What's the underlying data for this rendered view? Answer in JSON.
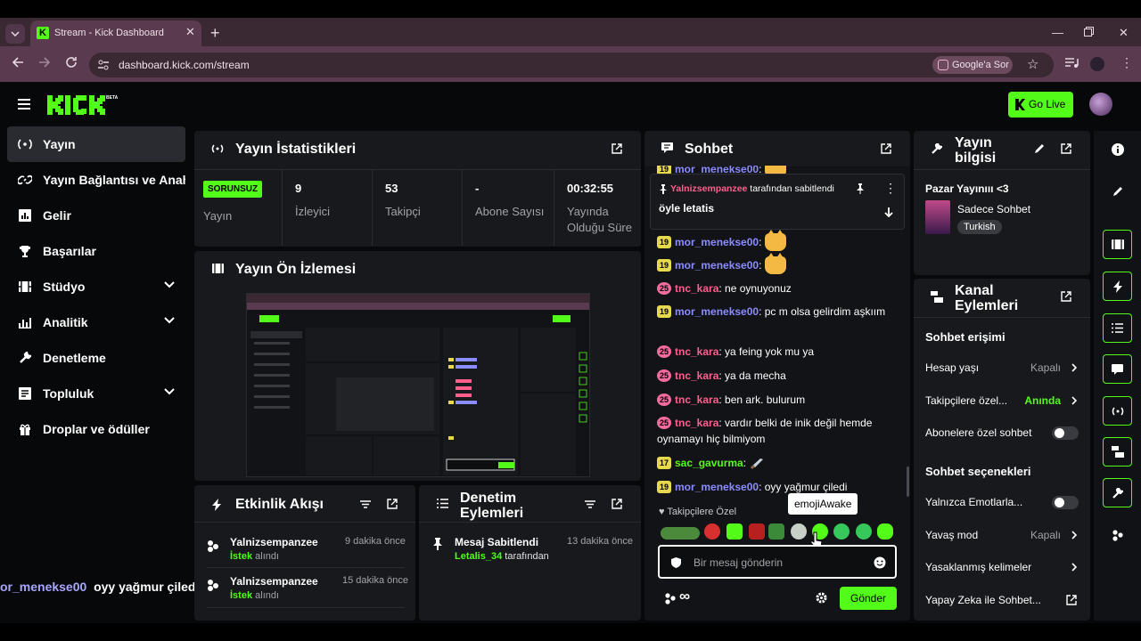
{
  "browser": {
    "tab_title": "Stream - Kick Dashboard",
    "url": "dashboard.kick.com/stream",
    "google_ask": "Google'a Sor"
  },
  "header": {
    "logo": "KICK",
    "beta": "BETA",
    "go_live": "Go Live"
  },
  "sidebar": {
    "items": [
      {
        "label": "Yayın"
      },
      {
        "label": "Yayın Bağlantısı ve Anahtarı"
      },
      {
        "label": "Gelir"
      },
      {
        "label": "Başarılar"
      },
      {
        "label": "Stüdyo"
      },
      {
        "label": "Analitik"
      },
      {
        "label": "Denetleme"
      },
      {
        "label": "Topluluk"
      },
      {
        "label": "Droplar ve ödüller"
      }
    ],
    "ticker_user": "or_menekse00",
    "ticker_text": "oyy yağmur çiledi"
  },
  "stats": {
    "title": "Yayın İstatistikleri",
    "badge": "SORUNSUZ",
    "items": [
      {
        "value": "",
        "label": "Yayın"
      },
      {
        "value": "9",
        "label": "İzleyici"
      },
      {
        "value": "53",
        "label": "Takipçi"
      },
      {
        "value": "-",
        "label": "Abone Sayısı"
      },
      {
        "value": "00:32:55",
        "label": "Yayında Olduğu Süre"
      }
    ]
  },
  "preview": {
    "title": "Yayın Ön İzlemesi"
  },
  "activity": {
    "title": "Etkinlik Akışı",
    "items": [
      {
        "name": "Yalnizsempanzee",
        "time": "9 dakika önce",
        "action": "İstek",
        "suffix": "alındı"
      },
      {
        "name": "Yalnizsempanzee",
        "time": "15 dakika önce",
        "action": "İstek",
        "suffix": "alındı"
      }
    ]
  },
  "moderation": {
    "title": "Denetim Eylemleri",
    "items": [
      {
        "action": "Mesaj Sabitlendi",
        "time": "13 dakika önce",
        "by": "Letalis_34",
        "suffix": "tarafından"
      }
    ]
  },
  "chat": {
    "title": "Sohbet",
    "pinned_by": "Yalnizsempanzee",
    "pinned_suffix": "tarafından sabitlendi",
    "pinned_text": "öyle letatis",
    "messages": [
      {
        "badge": "19",
        "user": "mor_menekse00",
        "text": ""
      },
      {
        "badge": "19",
        "user": "mor_menekse00",
        "text": ""
      },
      {
        "badge": "25",
        "user": "tnc_kara",
        "text": "ne oynuyonuz"
      },
      {
        "badge": "19",
        "user": "mor_menekse00",
        "text": "pc m olsa gelirdim aşkıım"
      },
      {
        "badge": "25",
        "user": "tnc_kara",
        "text": "ya feing yok mu ya"
      },
      {
        "badge": "25",
        "user": "tnc_kara",
        "text": "ya da mecha"
      },
      {
        "badge": "25",
        "user": "tnc_kara",
        "text": "ben ark. bulurum"
      },
      {
        "badge": "25",
        "user": "tnc_kara",
        "text": "vardır belki de inik değil hemde oynamayı hiç bilmiyom"
      },
      {
        "badge": "17",
        "user": "sac_gavurma",
        "text": ""
      },
      {
        "badge": "19",
        "user": "mor_menekse00",
        "text": "oyy yağmur çiledi"
      }
    ],
    "top_partial_user": "mor_menekse00",
    "followers_label": "Takipçilere Özel",
    "tooltip": "emojiAwake",
    "input_placeholder": "Bir mesaj gönderin",
    "send": "Gönder"
  },
  "stream_info": {
    "title": "Yayın bilgisi",
    "stream_title": "Pazar Yayınııı <3",
    "category": "Sadece Sohbet",
    "language": "Turkish"
  },
  "channel_actions": {
    "title": "Kanal Eylemleri",
    "chat_access": "Sohbet erişimi",
    "account_age": "Hesap yaşı",
    "account_age_value": "Kapalı",
    "followers_only": "Takipçilere özel...",
    "followers_only_value": "Anında",
    "subs_only": "Abonelere özel sohbet",
    "chat_options": "Sohbet seçenekleri",
    "emotes_only": "Yalnızca Emotlarla...",
    "slow_mode": "Yavaş mod",
    "slow_mode_value": "Kapalı",
    "banned_words": "Yasaklanmış kelimeler",
    "ai_mod": "Yapay Zeka ile Sohbet..."
  },
  "colors": {
    "accent": "#53fc18",
    "panel": "#18191c",
    "bg": "#07080a"
  }
}
